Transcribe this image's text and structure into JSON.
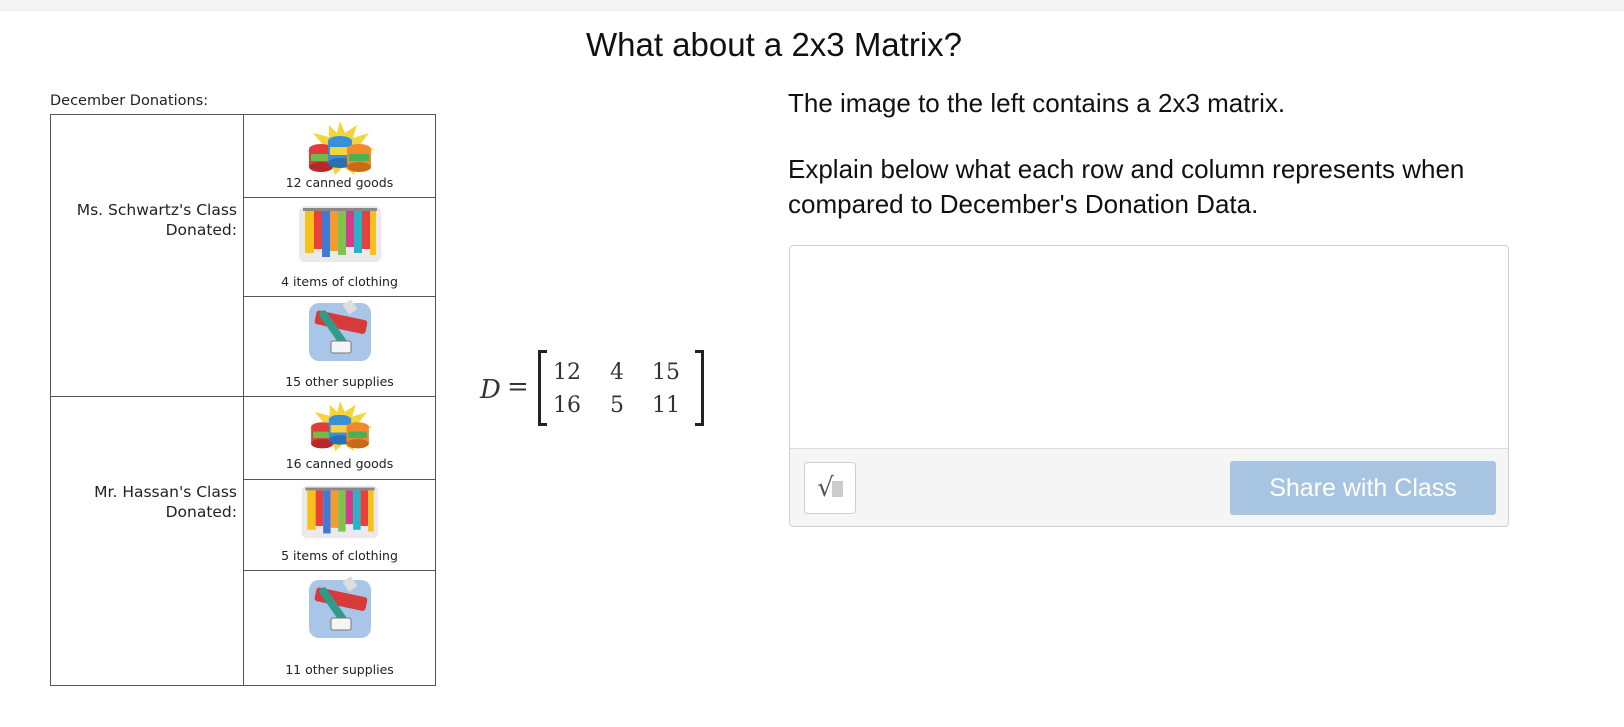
{
  "page": {
    "title": "What about a 2x3 Matrix?"
  },
  "table": {
    "caption": "December Donations:",
    "rows": [
      {
        "label": "Ms. Schwartz's Class\nDonated:",
        "items": [
          {
            "caption": "12 canned goods",
            "icon": "canned-goods-icon"
          },
          {
            "caption": "4 items of clothing",
            "icon": "clothing-rack-icon"
          },
          {
            "caption": "15 other supplies",
            "icon": "toothpaste-supplies-icon"
          }
        ]
      },
      {
        "label": "Mr. Hassan's Class\nDonated:",
        "items": [
          {
            "caption": "16 canned goods",
            "icon": "canned-goods-icon"
          },
          {
            "caption": "5 items of clothing",
            "icon": "clothing-rack-icon"
          },
          {
            "caption": "11 other supplies",
            "icon": "toothpaste-supplies-icon"
          }
        ]
      }
    ]
  },
  "matrix": {
    "label": "D",
    "equals": "=",
    "rows": [
      [
        "12",
        "4",
        "15"
      ],
      [
        "16",
        "5",
        "11"
      ]
    ]
  },
  "prompt": {
    "line1": "The image to the left contains a 2x3 matrix.",
    "line2": "Explain below what each row and column represents when compared to December's Donation Data."
  },
  "answer": {
    "value": "",
    "math_button_glyph": "√",
    "share_label": "Share with Class",
    "share_color": "#a7c5e1"
  }
}
